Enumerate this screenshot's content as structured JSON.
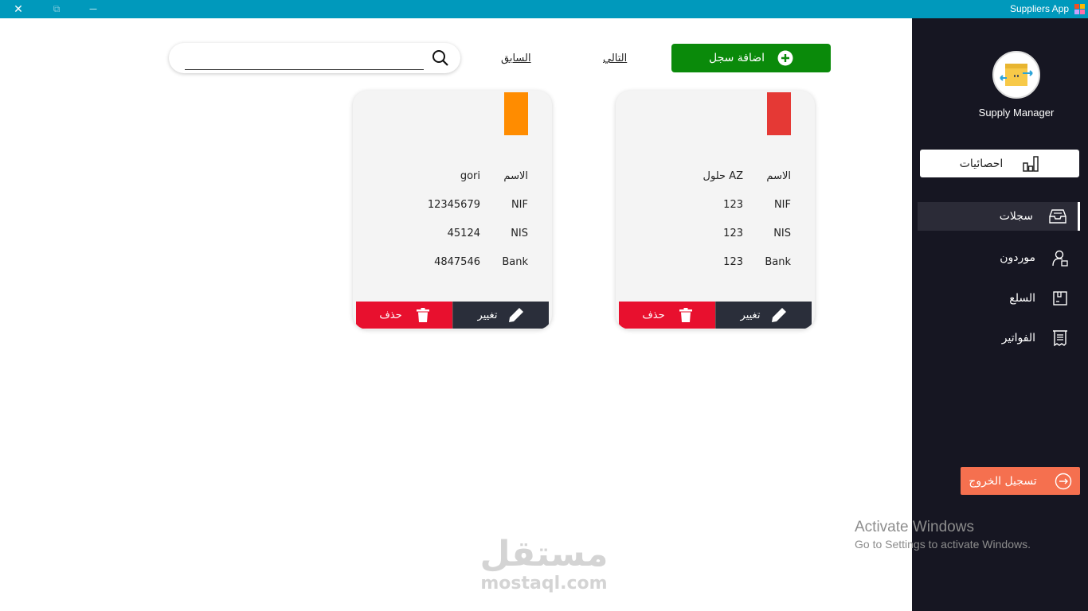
{
  "window": {
    "title": "Suppliers App",
    "close_glyph": "✕",
    "restore_glyph": "⧉",
    "minimize_glyph": "—"
  },
  "sidebar": {
    "brand": "Supply Manager",
    "stats_label": "احصائيات",
    "items": [
      {
        "label": "سجلات",
        "icon": "inbox-icon",
        "active": true
      },
      {
        "label": "موردون",
        "icon": "user-icon",
        "active": false
      },
      {
        "label": "السلع",
        "icon": "box-icon",
        "active": false
      },
      {
        "label": "الفواتير",
        "icon": "receipt-icon",
        "active": false
      }
    ],
    "logout_label": "تسجيل الخروج"
  },
  "toolbar": {
    "add_label": "اضافة سجل",
    "next_label": "التالي",
    "prev_label": "السابق",
    "search_value": "",
    "search_placeholder": ""
  },
  "cards": [
    {
      "tag_color": "#e53935",
      "rows": [
        {
          "label": "الاسم",
          "value": "حلول AZ"
        },
        {
          "label": "NIF",
          "value": "123"
        },
        {
          "label": "NIS",
          "value": "123"
        },
        {
          "label": "Bank",
          "value": "123"
        }
      ],
      "edit_label": "تغيير",
      "delete_label": "حذف"
    },
    {
      "tag_color": "#ff8c00",
      "rows": [
        {
          "label": "الاسم",
          "value": "gori"
        },
        {
          "label": "NIF",
          "value": "12345679"
        },
        {
          "label": "NIS",
          "value": "45124"
        },
        {
          "label": "Bank",
          "value": "4847546"
        }
      ],
      "edit_label": "تغيير",
      "delete_label": "حذف"
    }
  ],
  "watermarks": {
    "activate_title": "Activate Windows",
    "activate_sub": "Go to Settings to activate Windows.",
    "mostaql_ar": "مستقل",
    "mostaql_en": "mostaql.com"
  },
  "colors": {
    "titlebar": "#0099bc",
    "sidebar": "#161622",
    "add_button": "#0a8a0a",
    "delete_button": "#e8102e",
    "edit_button": "#2a2e3a",
    "logout_button": "#f5704f"
  }
}
